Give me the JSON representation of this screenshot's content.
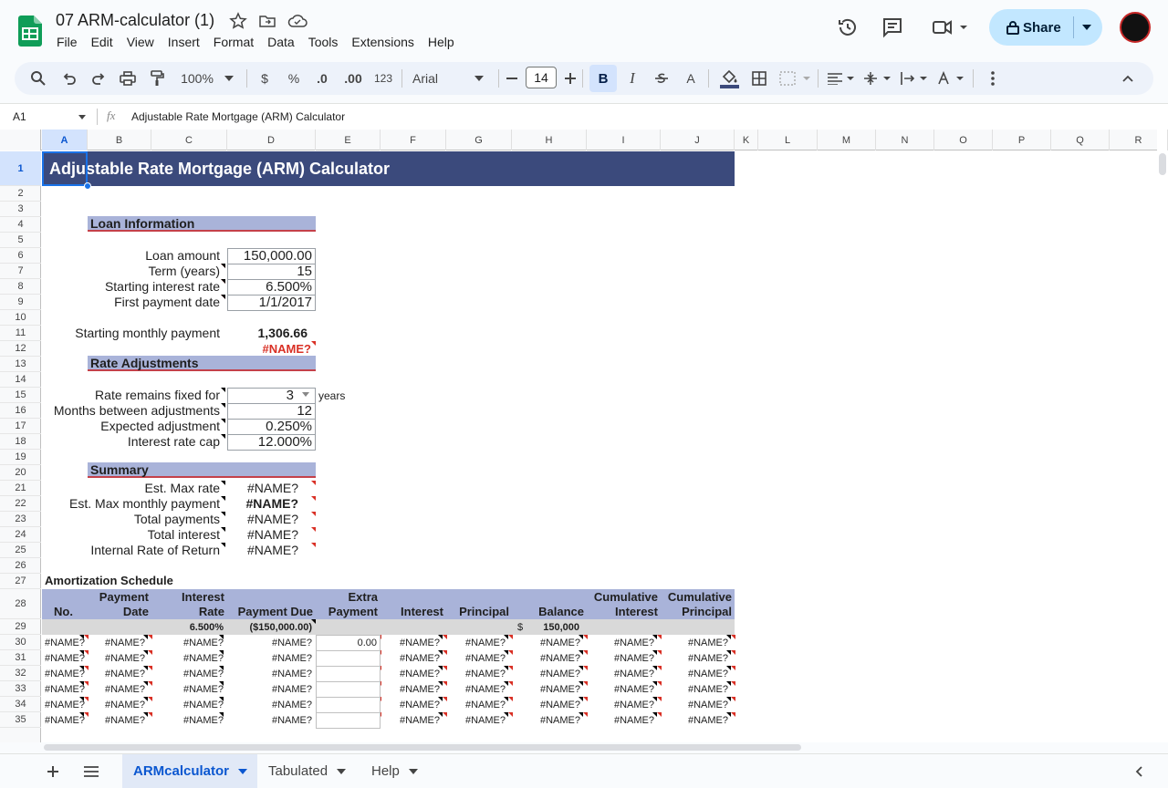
{
  "app": {
    "doc_title": "07 ARM-calculator (1)",
    "menus": [
      "File",
      "Edit",
      "View",
      "Insert",
      "Format",
      "Data",
      "Tools",
      "Extensions",
      "Help"
    ],
    "share_label": "Share"
  },
  "toolbar": {
    "zoom": "100%",
    "currency": "$",
    "percent": "%",
    "dec_decrease": ".0",
    "dec_increase": ".00",
    "number_format": "123",
    "font": "Arial",
    "font_size": "14",
    "bold": "B",
    "italic": "I",
    "text_color": "A"
  },
  "formula_bar": {
    "cell_ref": "A1",
    "fx": "fx",
    "value": "Adjustable Rate Mortgage (ARM) Calculator"
  },
  "columns": [
    "A",
    "B",
    "C",
    "D",
    "E",
    "F",
    "G",
    "H",
    "I",
    "J",
    "K",
    "L",
    "M",
    "N",
    "O",
    "P",
    "Q",
    "R"
  ],
  "rows": [
    "1",
    "2",
    "3",
    "4",
    "5",
    "6",
    "7",
    "8",
    "9",
    "10",
    "11",
    "12",
    "13",
    "14",
    "15",
    "16",
    "17",
    "18",
    "19",
    "20",
    "21",
    "22",
    "23",
    "24",
    "25",
    "26",
    "27",
    "28",
    "29",
    "30",
    "31",
    "32",
    "33",
    "34",
    "35"
  ],
  "sheet": {
    "title": "Adjustable Rate Mortgage (ARM) Calculator",
    "loan_info": {
      "header": "Loan Information",
      "loan_amount_label": "Loan amount",
      "loan_amount": "150,000.00",
      "term_label": "Term (years)",
      "term": "15",
      "rate_label": "Starting interest rate",
      "rate": "6.500%",
      "first_payment_label": "First payment date",
      "first_payment": "1/1/2017",
      "monthly_label": "Starting monthly payment",
      "monthly": "1,306.66",
      "error": "#NAME?"
    },
    "rate_adj": {
      "header": "Rate Adjustments",
      "fixed_label": "Rate remains fixed for",
      "fixed": "3",
      "years": "years",
      "months_label": "Months between adjustments",
      "months": "12",
      "expected_label": "Expected adjustment",
      "expected": "0.250%",
      "cap_label": "Interest rate cap",
      "cap": "12.000%"
    },
    "summary": {
      "header": "Summary",
      "items": [
        {
          "label": "Est. Max rate",
          "value": "#NAME?"
        },
        {
          "label": "Est. Max monthly payment",
          "value": "#NAME?"
        },
        {
          "label": "Total payments",
          "value": "#NAME?"
        },
        {
          "label": "Total interest",
          "value": "#NAME?"
        },
        {
          "label": "Internal Rate of Return",
          "value": "#NAME?"
        }
      ]
    },
    "amort": {
      "title": "Amortization Schedule",
      "headers": [
        [
          "",
          "No."
        ],
        [
          "Payment",
          "Date"
        ],
        [
          "Interest",
          "Rate"
        ],
        [
          "",
          "Payment Due"
        ],
        [
          "Extra",
          "Payment"
        ],
        [
          "",
          "Interest"
        ],
        [
          "",
          "Principal"
        ],
        [
          "",
          "Balance"
        ],
        [
          "Cumulative",
          "Interest"
        ],
        [
          "Cumulative",
          "Principal"
        ]
      ],
      "row0": {
        "rate": "6.500%",
        "due": "($150,000.00)",
        "dollar": "$",
        "balance": "150,000"
      },
      "extra_first": "0.00",
      "error": "#NAME?"
    }
  },
  "tabs": [
    "ARMcalculator",
    "Tabulated",
    "Help"
  ]
}
